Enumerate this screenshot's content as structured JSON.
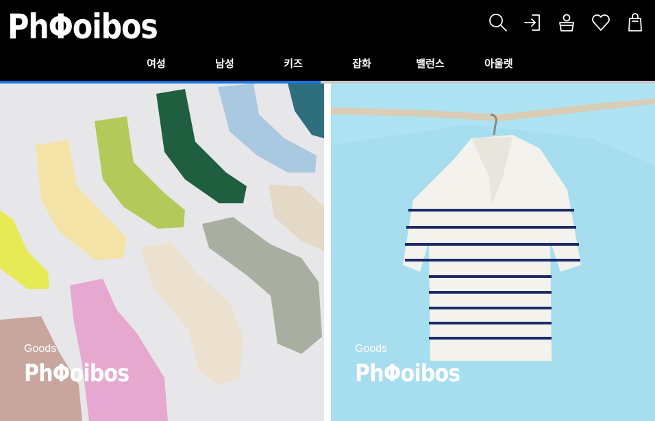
{
  "header": {
    "logo": "PhΦoibos",
    "icons": [
      "search-icon",
      "login-icon",
      "account-icon",
      "wishlist-icon",
      "cart-icon"
    ]
  },
  "nav": {
    "items": [
      "여성",
      "남성",
      "키즈",
      "잡화",
      "밸런스",
      "아울렛"
    ]
  },
  "banners": [
    {
      "sub": "Goods",
      "brand": "PhΦoibos",
      "image": "colorful ribbed socks"
    },
    {
      "sub": "Goods",
      "brand": "PhΦoibos",
      "image": "striped knit polo on hanger"
    }
  ],
  "colors": {
    "accent": "#1a73e8",
    "header": "#000000"
  }
}
